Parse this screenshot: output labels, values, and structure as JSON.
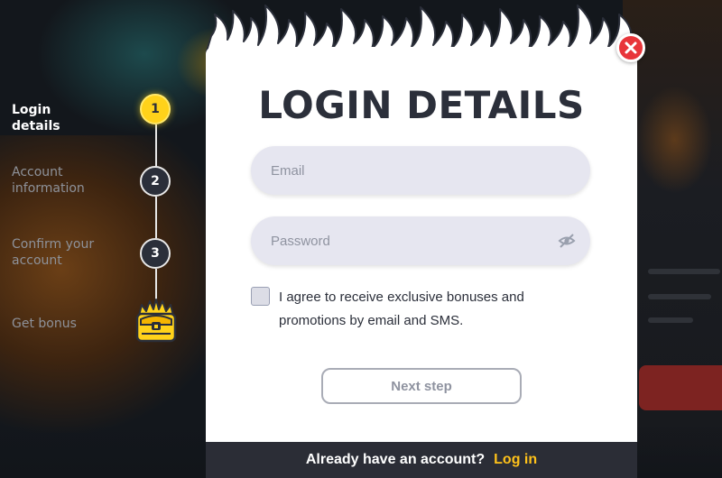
{
  "steps": [
    {
      "number": "1",
      "label": "Login details",
      "active": true
    },
    {
      "number": "2",
      "label": "Account information",
      "active": false
    },
    {
      "number": "3",
      "label": "Confirm your account",
      "active": false
    },
    {
      "number": "",
      "label": "Get bonus",
      "icon": "treasure-chest-icon",
      "active": false
    }
  ],
  "modal": {
    "title": "LOGIN DETAILS",
    "email_placeholder": "Email",
    "email_value": "",
    "password_placeholder": "Password",
    "password_value": "",
    "consent_line1": "I agree to receive exclusive bonuses and",
    "consent_line2": "promotions by email and SMS.",
    "consent_checked": false,
    "next_button": "Next step",
    "footer_text": "Already have an account?",
    "footer_link": "Log in"
  },
  "icons": {
    "close": "close-icon",
    "password_toggle": "eye-off-icon",
    "decoration": "flames-icon"
  },
  "colors": {
    "accent_yellow": "#ffd21a",
    "link_yellow": "#ffc21a",
    "close_red": "#e8353a",
    "dark_text": "#2b2f3a",
    "field_bg": "#e6e6f0",
    "footer_bg": "#2b2d36"
  }
}
